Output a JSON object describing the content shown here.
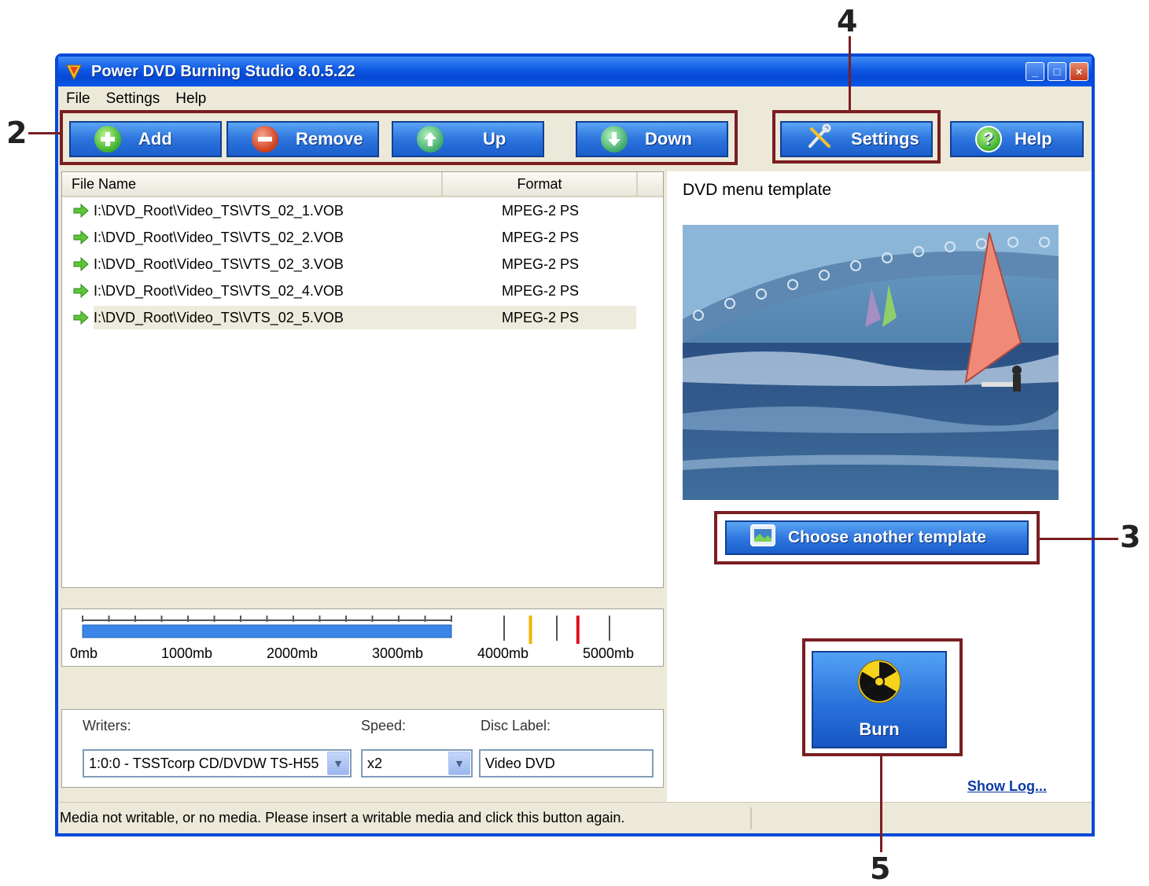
{
  "window": {
    "title": "Power DVD Burning Studio 8.0.5.22",
    "title_buttons": [
      "_",
      "□",
      "×"
    ]
  },
  "menu": [
    "File",
    "Settings",
    "Help"
  ],
  "toolbar": {
    "add_label": "Add",
    "remove_label": "Remove",
    "up_label": "Up",
    "down_label": "Down",
    "settings_label": "Settings",
    "help_label": "Help"
  },
  "file_list": {
    "columns": [
      "File Name",
      "Format"
    ],
    "rows": [
      {
        "name": "I:\\DVD_Root\\Video_TS\\VTS_02_1.VOB",
        "format": "MPEG-2 PS"
      },
      {
        "name": "I:\\DVD_Root\\Video_TS\\VTS_02_2.VOB",
        "format": "MPEG-2 PS"
      },
      {
        "name": "I:\\DVD_Root\\Video_TS\\VTS_02_3.VOB",
        "format": "MPEG-2 PS"
      },
      {
        "name": "I:\\DVD_Root\\Video_TS\\VTS_02_4.VOB",
        "format": "MPEG-2 PS"
      },
      {
        "name": "I:\\DVD_Root\\Video_TS\\VTS_02_5.VOB",
        "format": "MPEG-2 PS"
      }
    ],
    "selected_row": 4
  },
  "capacity": {
    "labels": [
      "0mb",
      "1000mb",
      "2000mb",
      "3000mb",
      "4000mb",
      "5000mb"
    ],
    "used_mb": 3500,
    "marker_colors": {
      "used": "#3a86e8",
      "warning": "#f0b400",
      "limit": "#e0101c"
    }
  },
  "writer_panel": {
    "writers_label": "Writers:",
    "writer_value": "1:0:0 - TSSTcorp CD/DVDW TS-H55",
    "speed_label": "Speed:",
    "speed_value": "x2",
    "disc_label_label": "Disc Label:",
    "disc_label_value": "Video DVD"
  },
  "right_panel": {
    "template_label": "DVD menu template",
    "choose_button": "Choose another template",
    "burn_button": "Burn",
    "show_log": "Show Log..."
  },
  "status": {
    "message": "Media not writable, or no media. Please insert a writable media and click this button again."
  },
  "callouts": {
    "c2": "2",
    "c3": "3",
    "c4": "4",
    "c5": "5",
    "color": "#7a1e22"
  },
  "icons": {
    "app": "app-logo-icon",
    "add": "plus-icon",
    "remove": "minus-icon",
    "up": "arrow-up-icon",
    "down": "arrow-down-icon",
    "settings": "tools-icon",
    "help": "question-icon",
    "file": "green-arrow-icon",
    "template": "image-icon",
    "burn": "radiation-icon"
  }
}
